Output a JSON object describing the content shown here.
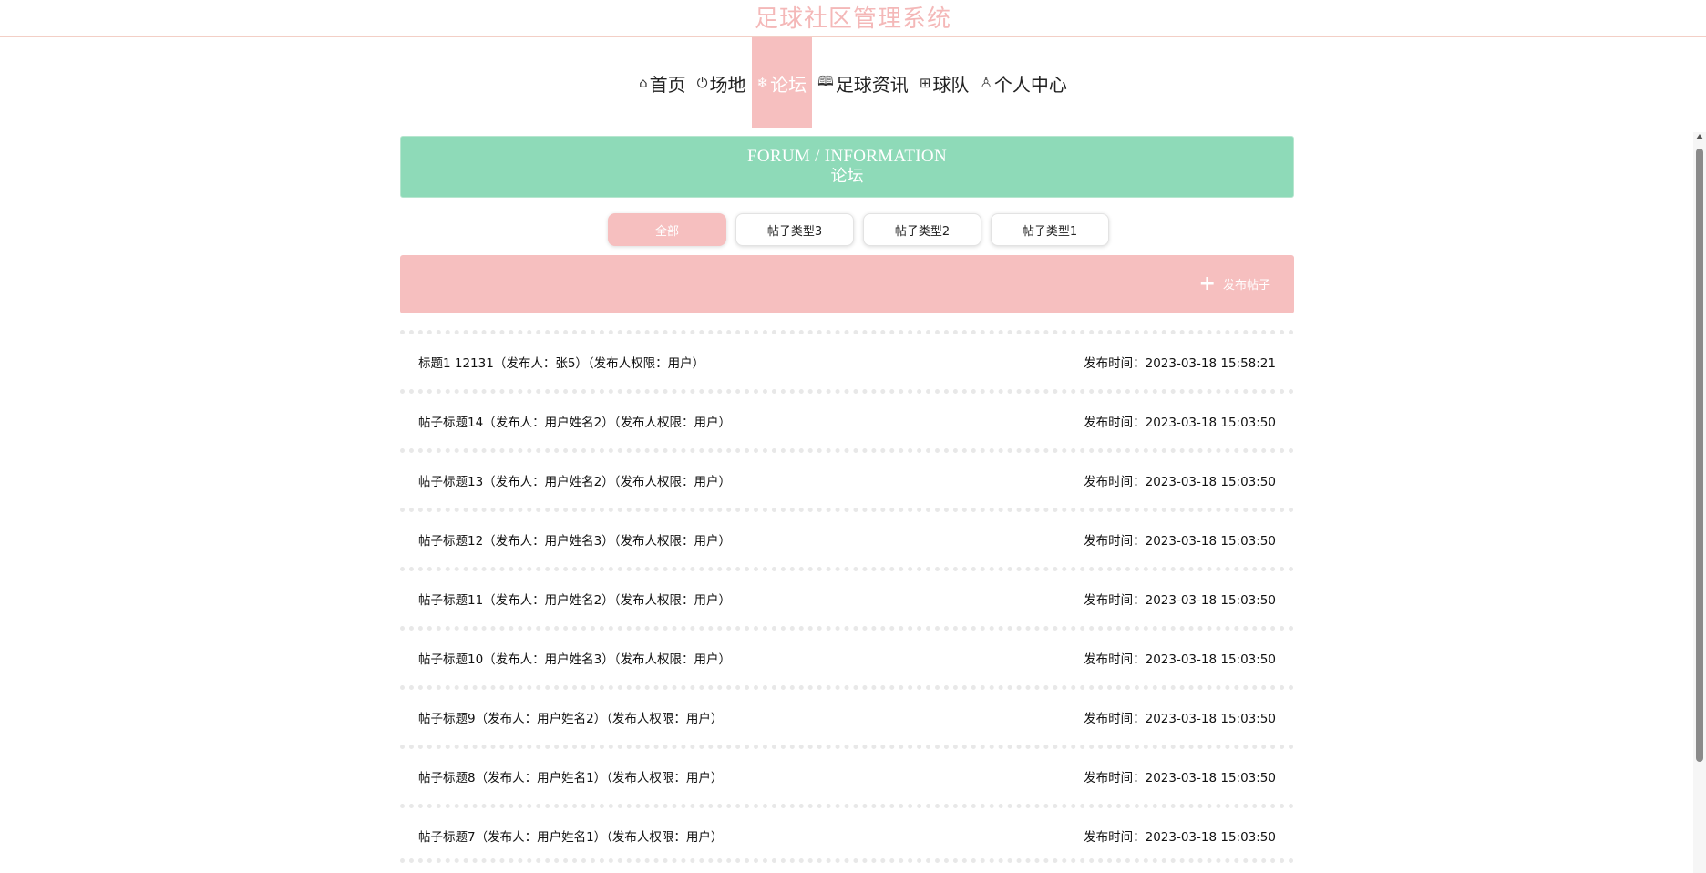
{
  "header": {
    "site_title": "足球社区管理系统"
  },
  "nav": {
    "items": [
      {
        "label": "首页",
        "icon": "home-icon",
        "glyph": "⌂"
      },
      {
        "label": "场地",
        "icon": "power-icon",
        "glyph": "⏻"
      },
      {
        "label": "论坛",
        "icon": "snowflake-icon",
        "glyph": "❄",
        "active": true
      },
      {
        "label": "足球资讯",
        "icon": "reader-icon",
        "glyph": "🕮"
      },
      {
        "label": "球队",
        "icon": "grid-icon",
        "glyph": "⊞"
      },
      {
        "label": "个人中心",
        "icon": "user-icon",
        "glyph": "♙"
      }
    ]
  },
  "banner": {
    "title_en": "FORUM / INFORMATION",
    "title_zh": "论坛"
  },
  "filters": {
    "items": [
      "全部",
      "帖子类型3",
      "帖子类型2",
      "帖子类型1"
    ],
    "active": "全部"
  },
  "publish": {
    "label": "发布帖子",
    "icon": "plus-icon"
  },
  "posts": [
    {
      "title": "标题1 12131（发布人：张5）（发布人权限：用户）",
      "time": "发布时间：2023-03-18 15:58:21"
    },
    {
      "title": "帖子标题14（发布人：用户姓名2）（发布人权限：用户）",
      "time": "发布时间：2023-03-18 15:03:50"
    },
    {
      "title": "帖子标题13（发布人：用户姓名2）（发布人权限：用户）",
      "time": "发布时间：2023-03-18 15:03:50"
    },
    {
      "title": "帖子标题12（发布人：用户姓名3）（发布人权限：用户）",
      "time": "发布时间：2023-03-18 15:03:50"
    },
    {
      "title": "帖子标题11（发布人：用户姓名2）（发布人权限：用户）",
      "time": "发布时间：2023-03-18 15:03:50"
    },
    {
      "title": "帖子标题10（发布人：用户姓名3）（发布人权限：用户）",
      "time": "发布时间：2023-03-18 15:03:50"
    },
    {
      "title": "帖子标题9（发布人：用户姓名2）（发布人权限：用户）",
      "time": "发布时间：2023-03-18 15:03:50"
    },
    {
      "title": "帖子标题8（发布人：用户姓名1）（发布人权限：用户）",
      "time": "发布时间：2023-03-18 15:03:50"
    },
    {
      "title": "帖子标题7（发布人：用户姓名1）（发布人权限：用户）",
      "time": "发布时间：2023-03-18 15:03:50"
    }
  ],
  "colors": {
    "accent_pink": "#f6bfbf",
    "banner_green": "#8edab8"
  }
}
